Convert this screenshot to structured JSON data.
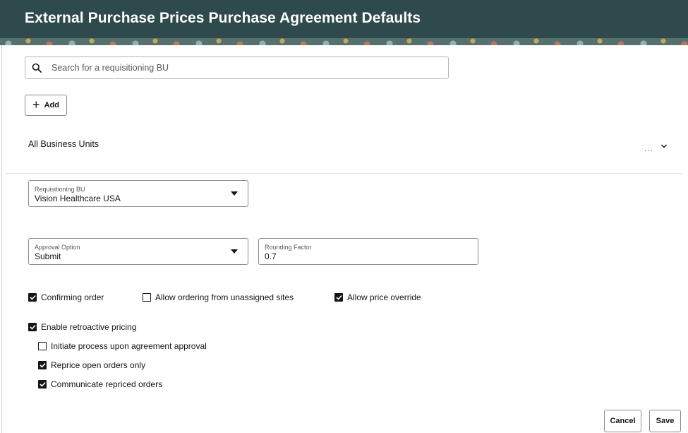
{
  "header": {
    "title": "External Purchase Prices Purchase Agreement Defaults"
  },
  "search": {
    "placeholder": "Search for a requisitioning BU",
    "value": ""
  },
  "toolbar": {
    "add_label": "Add"
  },
  "group": {
    "title": "All Business Units",
    "more_label": "..."
  },
  "fields": {
    "requisitioning_bu": {
      "label": "Requisitioning BU",
      "value": "Vision Healthcare USA"
    },
    "approval_option": {
      "label": "Approval Option",
      "value": "Submit"
    },
    "rounding_factor": {
      "label": "Rounding Factor",
      "value": "0.7"
    }
  },
  "checkboxes": {
    "confirming_order": {
      "label": "Confirming order",
      "checked": true
    },
    "allow_unassigned_sites": {
      "label": "Allow ordering from unassigned sites",
      "checked": false
    },
    "allow_price_override": {
      "label": "Allow price override",
      "checked": true
    },
    "enable_retroactive": {
      "label": "Enable retroactive pricing",
      "checked": true
    },
    "initiate_process": {
      "label": "Initiate process upon agreement approval",
      "checked": false
    },
    "reprice_open_only": {
      "label": "Reprice open orders only",
      "checked": true
    },
    "communicate_repriced": {
      "label": "Communicate repriced orders",
      "checked": true
    }
  },
  "footer": {
    "cancel_label": "Cancel",
    "save_label": "Save"
  }
}
